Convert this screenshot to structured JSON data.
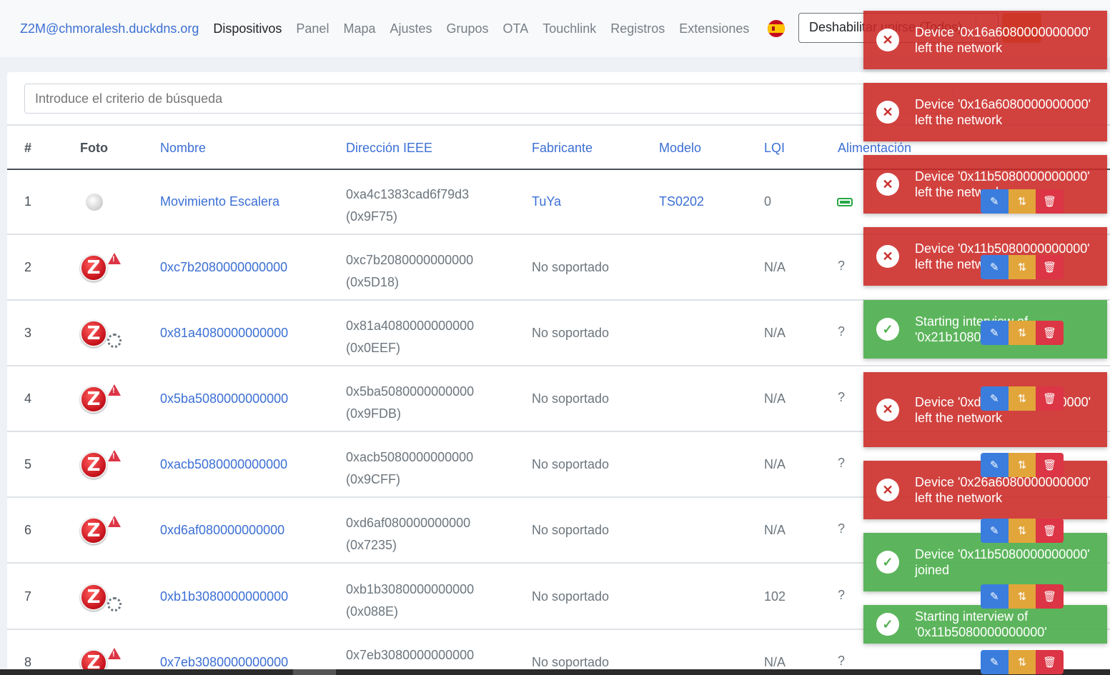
{
  "navbar": {
    "brand": "Z2M@chmoralesh.duckdns.org",
    "links": [
      "Dispositivos",
      "Panel",
      "Mapa",
      "Ajustes",
      "Grupos",
      "OTA",
      "Touchlink",
      "Registros",
      "Extensiones"
    ],
    "permit_join": "Deshabilitar unirse (Todos)",
    "language_icon": "spain-flag-icon"
  },
  "search": {
    "placeholder": "Introduce el criterio de búsqueda"
  },
  "table": {
    "headers": [
      "#",
      "Foto",
      "Nombre",
      "Dirección IEEE",
      "Fabricante",
      "Modelo",
      "LQI",
      "Alimentación"
    ],
    "rows": [
      {
        "num": "1",
        "name": "Movimiento Escalera",
        "ieee": "0xa4c1383cad6f79d3",
        "nwk": "(0x9F75)",
        "maker": "TuYa",
        "model": "TS0202",
        "lqi": "0",
        "power": "",
        "photo": "sensor"
      },
      {
        "num": "2",
        "name": "0xc7b2080000000000",
        "ieee": "0xc7b2080000000000",
        "nwk": "(0x5D18)",
        "maker": "No soportado",
        "model": "",
        "lqi": "N/A",
        "power": "?",
        "photo": "warn"
      },
      {
        "num": "3",
        "name": "0x81a4080000000000",
        "ieee": "0x81a4080000000000",
        "nwk": "(0x0EEF)",
        "maker": "No soportado",
        "model": "",
        "lqi": "N/A",
        "power": "?",
        "photo": "spin"
      },
      {
        "num": "4",
        "name": "0x5ba5080000000000",
        "ieee": "0x5ba5080000000000",
        "nwk": "(0x9FDB)",
        "maker": "No soportado",
        "model": "",
        "lqi": "N/A",
        "power": "?",
        "photo": "warn"
      },
      {
        "num": "5",
        "name": "0xacb5080000000000",
        "ieee": "0xacb5080000000000",
        "nwk": "(0x9CFF)",
        "maker": "No soportado",
        "model": "",
        "lqi": "N/A",
        "power": "?",
        "photo": "warn"
      },
      {
        "num": "6",
        "name": "0xd6af080000000000",
        "ieee": "0xd6af080000000000",
        "nwk": "(0x7235)",
        "maker": "No soportado",
        "model": "",
        "lqi": "N/A",
        "power": "?",
        "photo": "warn"
      },
      {
        "num": "7",
        "name": "0xb1b3080000000000",
        "ieee": "0xb1b3080000000000",
        "nwk": "(0x088E)",
        "maker": "No soportado",
        "model": "",
        "lqi": "102",
        "power": "?",
        "photo": "spin"
      },
      {
        "num": "8",
        "name": "0x7eb3080000000000",
        "ieee": "0x7eb3080000000000",
        "nwk": "",
        "maker": "No soportado",
        "model": "",
        "lqi": "N/A",
        "power": "?",
        "photo": "warn"
      }
    ]
  },
  "toasts": [
    {
      "type": "error",
      "text": "Device '0x16a6080000000000' left the network"
    },
    {
      "type": "error",
      "text": "Device '0x16a6080000000000' left the network"
    },
    {
      "type": "error",
      "text": "Device '0x11b5080000000000' left the network"
    },
    {
      "type": "error",
      "text": "Device '0x11b5080000000000' left the network"
    },
    {
      "type": "success",
      "text": "Starting interview of '0x21b1080000000000'"
    },
    {
      "type": "error",
      "text": "Device '0xdba5080000000000' left the network"
    },
    {
      "type": "error",
      "text": "Device '0x26a6080000000000' left the network"
    },
    {
      "type": "success",
      "text": "Device '0x11b5080000000000' joined"
    },
    {
      "type": "success",
      "text": "Starting interview of '0x11b5080000000000'"
    }
  ],
  "icons": {
    "error": "times-circle-icon",
    "success": "check-circle-icon",
    "edit": "edit-icon",
    "rename": "retweet-icon",
    "delete": "trash-icon"
  }
}
